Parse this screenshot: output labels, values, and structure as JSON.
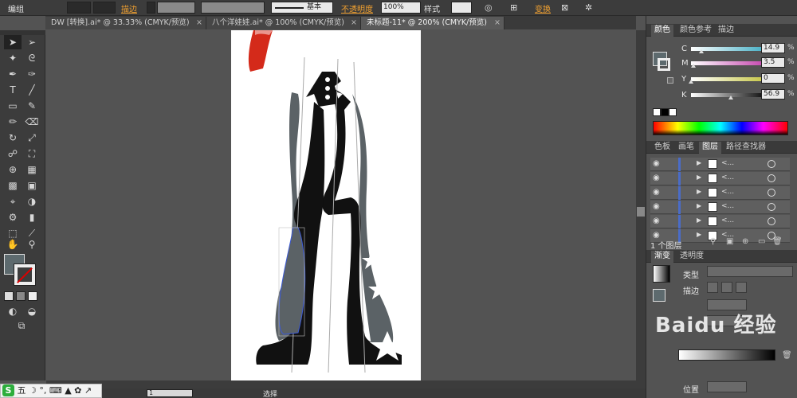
{
  "control_bar": {
    "group_label": "编组",
    "stroke_label": "描边",
    "brush_label": "基本",
    "opacity_label": "不透明度",
    "opacity_value": "100%",
    "style_label": "样式",
    "transform_label": "变换"
  },
  "tabs": [
    {
      "label": "DW [转换].ai* @ 33.33% (CMYK/预览)"
    },
    {
      "label": "八个洋娃娃.ai* @ 100% (CMYK/预览)"
    },
    {
      "label": "未标题-11* @ 200% (CMYK/预览)"
    }
  ],
  "tabs_close_glyph": "×",
  "color_panel": {
    "tabs": [
      "颜色",
      "颜色参考",
      "描边"
    ],
    "rows": [
      {
        "k": "C",
        "value": "14.9",
        "level": 0.149,
        "color": "#4fb3c8"
      },
      {
        "k": "M",
        "value": "3.5",
        "level": 0.035,
        "color": "#c84fb3"
      },
      {
        "k": "Y",
        "value": "0",
        "level": 0.0,
        "color": "#c8c84f"
      },
      {
        "k": "K",
        "value": "56.9",
        "level": 0.569,
        "color": "#1a1a1a"
      }
    ],
    "percent_sign": "%"
  },
  "layers_panel": {
    "tabs": [
      "色板",
      "画笔",
      "图层",
      "路径查找器"
    ],
    "rows": [
      {
        "name": "<...",
        "tri": "▶"
      },
      {
        "name": "<...",
        "tri": "▶"
      },
      {
        "name": "<...",
        "tri": "▶"
      },
      {
        "name": "<...",
        "tri": "▶"
      },
      {
        "name": "<...",
        "tri": "▶"
      },
      {
        "name": "<...",
        "tri": "▶"
      }
    ],
    "footer": "1 个图层"
  },
  "gradient_panel": {
    "tabs": [
      "渐变",
      "透明度"
    ],
    "type_label": "类型",
    "stroke_label": "描边",
    "position_label": "位置"
  },
  "status_bar": {
    "zoom_value": "1",
    "selection_label": "选择"
  },
  "ime": {
    "logo": "S",
    "text": "五 ☽ °, ⌨ ▲ ✿ ↗"
  },
  "watermark": "Baidu 经验",
  "colors": {
    "fill_swatch": "#5d6a6e",
    "cape_red": "#d42a1a",
    "figure_dark": "#111111",
    "figure_gray": "#5b6266",
    "selection_blue": "#3d5bd6"
  }
}
